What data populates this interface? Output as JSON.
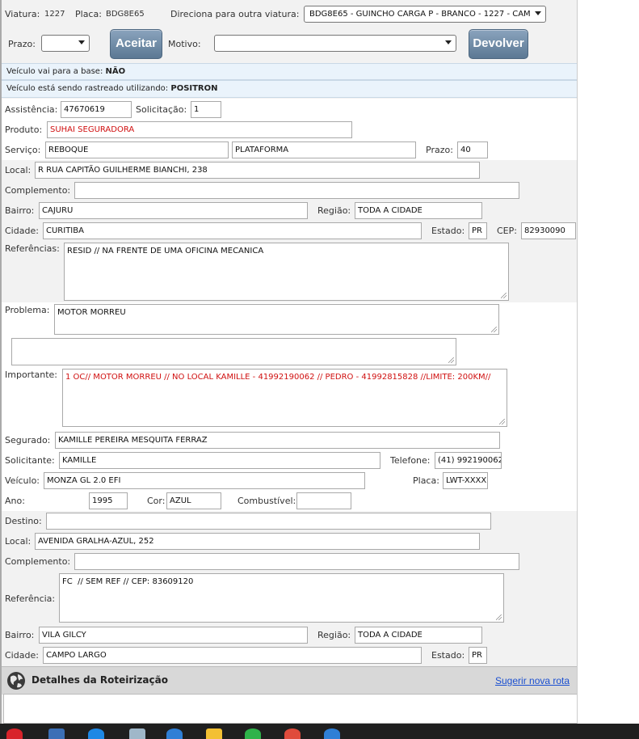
{
  "header": {
    "viatura_label": "Viatura:",
    "viatura_value": "1227",
    "placa_label": "Placa:",
    "placa_value": "BDG8E65",
    "direciona_label": "Direciona para outra viatura:",
    "direciona_value": "BDG8E65 - GUINCHO CARGA P - BRANCO - 1227 - CAM",
    "prazo_label": "Prazo:",
    "prazo_value": "",
    "aceitar_label": "Aceitar",
    "motivo_label": "Motivo:",
    "motivo_value": "",
    "devolver_label": "Devolver"
  },
  "info": {
    "base_label": "Veículo vai para a base:",
    "base_value": "NÃO",
    "rastreado_label": "Veículo está sendo rastreado utilizando:",
    "rastreado_value": "POSITRON"
  },
  "form": {
    "assistencia_label": "Assistência:",
    "assistencia_value": "47670619",
    "solicitacao_label": "Solicitação:",
    "solicitacao_value": "1",
    "produto_label": "Produto:",
    "produto_value": "SUHAI SEGURADORA",
    "servico_label": "Serviço:",
    "servico_value": "REBOQUE",
    "servico_tipo": "PLATAFORMA",
    "prazo_label": "Prazo:",
    "prazo_value": "40",
    "local_label": "Local:",
    "local_value": "R RUA CAPITÃO GUILHERME BIANCHI, 238",
    "complemento_label": "Complemento:",
    "complemento_value": "",
    "bairro_label": "Bairro:",
    "bairro_value": "CAJURU",
    "regiao_label": "Região:",
    "regiao_value": "TODA A CIDADE",
    "cidade_label": "Cidade:",
    "cidade_value": "CURITIBA",
    "estado_label": "Estado:",
    "estado_value": "PR",
    "cep_label": "CEP:",
    "cep_value": "82930090",
    "referencias_label": "Referências:",
    "referencias_value": "RESID // NA FRENTE DE UMA OFICINA MECANICA",
    "problema_label": "Problema:",
    "problema_value": "MOTOR MORREU",
    "problema_extra": "",
    "importante_label": "Importante:",
    "importante_value": "1 OC// MOTOR MORREU // NO LOCAL KAMILLE - 41992190062 // PEDRO - 41992815828 //LIMITE: 200KM//",
    "segurado_label": "Segurado:",
    "segurado_value": "KAMILLE PEREIRA MESQUITA FERRAZ",
    "solicitante_label": "Solicitante:",
    "solicitante_value": "KAMILLE",
    "telefone_label": "Telefone:",
    "telefone_value": "(41) 992190062",
    "veiculo_label": "Veículo:",
    "veiculo_value": "MONZA GL 2.0 EFI",
    "placa_label": "Placa:",
    "placa_value": "LWT-XXXX",
    "ano_label": "Ano:",
    "ano_value": "1995",
    "cor_label": "Cor:",
    "cor_value": "AZUL",
    "combustivel_label": "Combustível:",
    "combustivel_value": ""
  },
  "destino": {
    "destino_label": "Destino:",
    "destino_value": "",
    "local_label": "Local:",
    "local_value": "AVENIDA GRALHA-AZUL, 252",
    "complemento_label": "Complemento:",
    "complemento_value": "",
    "referencia_label": "Referência:",
    "referencia_value": "FC  // SEM REF // CEP: 83609120",
    "bairro_label": "Bairro:",
    "bairro_value": "VILA GILCY",
    "regiao_label": "Região:",
    "regiao_value": "TODA A CIDADE",
    "cidade_label": "Cidade:",
    "cidade_value": "CAMPO LARGO",
    "estado_label": "Estado:",
    "estado_value": "PR"
  },
  "footer": {
    "title": "Detalhes da Roteirização",
    "link": "Sugerir nova rota"
  },
  "colors": {
    "accent_red": "#d01010",
    "link_blue": "#1a4fd0",
    "button": "#6b87a3"
  }
}
